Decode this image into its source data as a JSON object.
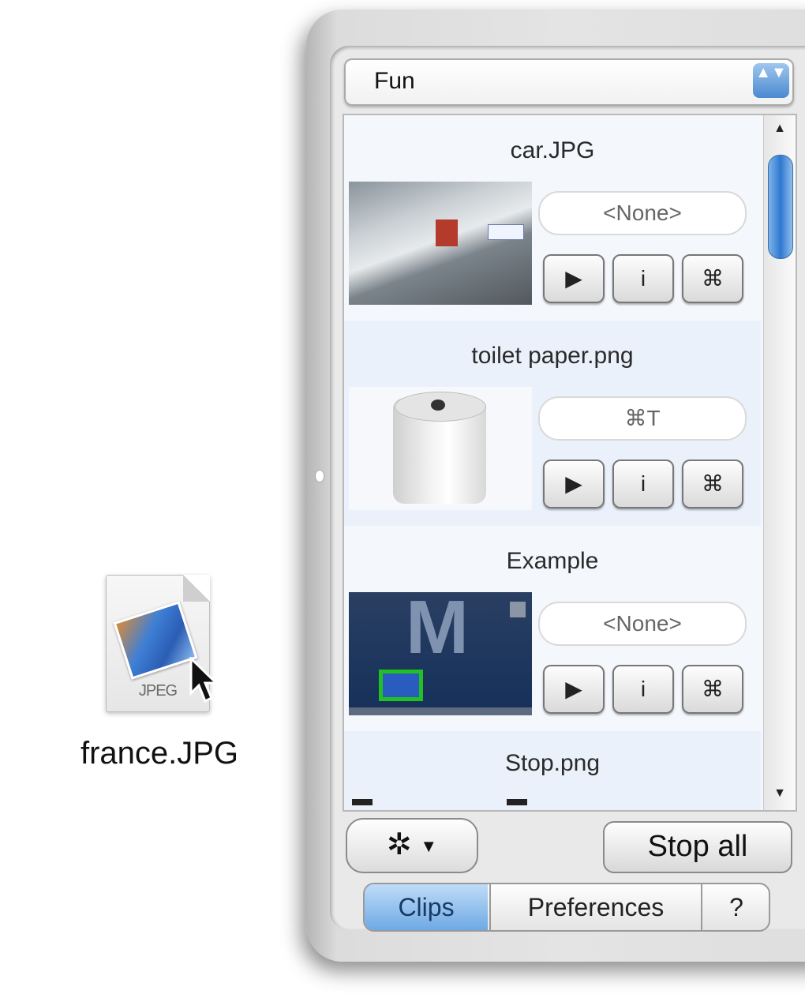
{
  "desktop": {
    "file": {
      "name": "france.JPG",
      "type_label": "JPEG"
    }
  },
  "window": {
    "category_popup": {
      "value": "Fun",
      "arrows": "▲▼"
    },
    "clips": [
      {
        "title": "car.JPG",
        "shortcut": "<None>"
      },
      {
        "title": "toilet paper.png",
        "shortcut": "⌘T"
      },
      {
        "title": "Example",
        "shortcut": "<None>"
      },
      {
        "title": "Stop.png"
      }
    ],
    "clip_buttons": {
      "play": "▶",
      "info": "i",
      "command": "⌘"
    },
    "scrollbar": {
      "up": "▲",
      "down": "▼"
    },
    "action_menu": {
      "icon": "✲",
      "caret": "▼"
    },
    "stop_all": "Stop all",
    "tabs": {
      "clips": "Clips",
      "preferences": "Preferences",
      "help": "?"
    }
  }
}
